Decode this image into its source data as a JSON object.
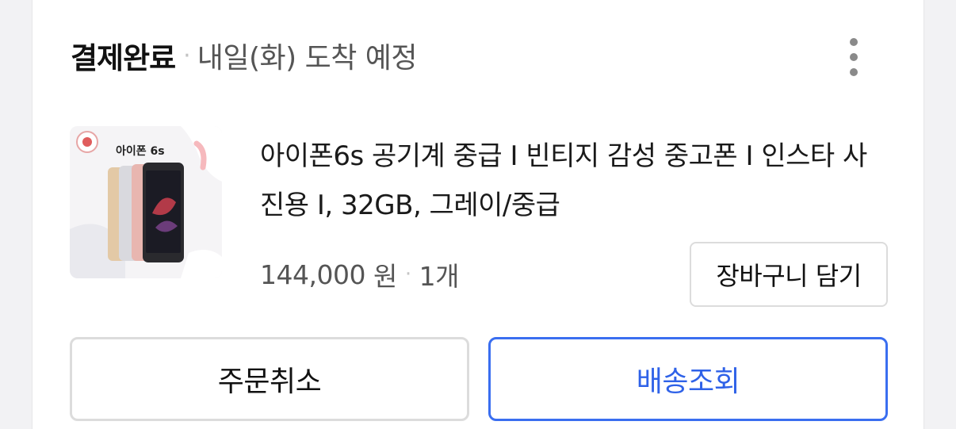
{
  "order": {
    "status": "결제완료",
    "delivery_eta": "내일(화) 도착 예정"
  },
  "product": {
    "thumbnail_label": "아이폰 6s",
    "title": "아이폰6s 공기계 중급 I 빈티지 감성 중고폰 I 인스타 사진용 I, 32GB, 그레이/중급",
    "price": "144,000",
    "currency": "원",
    "quantity": "1개"
  },
  "actions": {
    "add_to_cart": "장바구니 담기",
    "cancel_order": "주문취소",
    "track_delivery": "배송조회"
  },
  "colors": {
    "accent": "#2f62e8",
    "text_primary": "#111111",
    "text_secondary": "#555555",
    "border": "#dcdcdc"
  },
  "icons": {
    "more": "more-vertical-icon"
  }
}
